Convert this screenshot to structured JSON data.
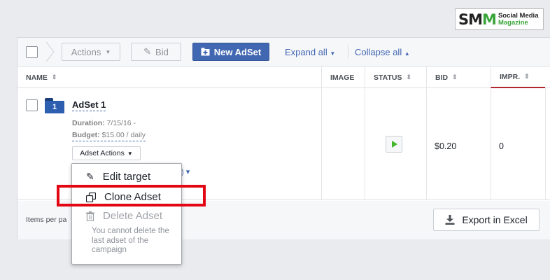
{
  "logo": {
    "mark_a": "SM",
    "mark_b": "M",
    "line1": "Social Media",
    "line2": "Magazine"
  },
  "toolbar": {
    "actions_label": "Actions",
    "bid_label": "Bid",
    "new_adset_label": "New AdSet",
    "expand_all_label": "Expand all",
    "collapse_all_label": "Collapse all"
  },
  "table": {
    "columns": [
      {
        "label": "NAME",
        "sortable": true
      },
      {
        "label": "IMAGE",
        "sortable": false
      },
      {
        "label": "STATUS",
        "sortable": true
      },
      {
        "label": "BID",
        "sortable": true
      },
      {
        "label": "IMPR.",
        "sortable": true
      }
    ],
    "rows": [
      {
        "index": "1",
        "name": "AdSet 1",
        "duration_label": "Duration:",
        "duration_value": "7/15/16 -",
        "budget_label": "Budget:",
        "budget_value": "$15.00 / daily",
        "actions_label": "Adset Actions",
        "status": "active",
        "bid": "$0.20",
        "impressions": "0"
      }
    ]
  },
  "footer": {
    "items_per_page_label": "Items per pa",
    "export_label": "Export in Excel"
  },
  "menu": {
    "items": [
      {
        "label": "Edit target",
        "icon": "pencil-icon",
        "enabled": true
      },
      {
        "label": "Clone Adset",
        "icon": "clone-icon",
        "enabled": true
      },
      {
        "label": "Delete Adset",
        "icon": "trash-icon",
        "enabled": false
      }
    ],
    "note": "You cannot delete the last adset of the campaign"
  },
  "colors": {
    "accent": "#4267b2",
    "highlight": "#e30613",
    "impr_underline": "#b1262c",
    "play": "#42b72a"
  }
}
